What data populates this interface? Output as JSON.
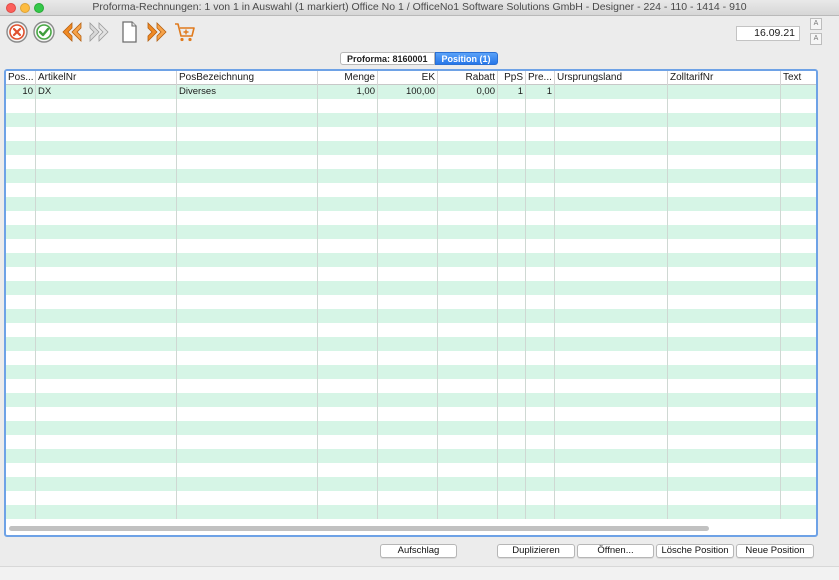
{
  "window": {
    "title": "Proforma-Rechnungen: 1 von 1 in Auswahl  (1 markiert) Office No 1 /  OfficeNo1 Software Solutions GmbH - Designer - 224 - 110 - 1414 - 910"
  },
  "toolbar": {
    "buttons": [
      "cancel-icon",
      "confirm-icon",
      "previous-icon",
      "next-icon",
      "new-document-icon",
      "fast-forward-icon",
      "cart-add-icon"
    ],
    "date": "16.09.21",
    "font_increase": "A",
    "font_decrease": "A"
  },
  "tabs": [
    {
      "label": "Proforma: 8160001",
      "active": false
    },
    {
      "label": "Position (1)",
      "active": true
    }
  ],
  "table": {
    "columns": [
      "Pos...",
      "ArtikelNr",
      "PosBezeichnung",
      "Menge",
      "EK",
      "Rabatt",
      "PpS",
      "Pre...",
      "Ursprungsland",
      "ZolltarifNr",
      "Text"
    ],
    "rows": [
      [
        "10",
        "DX",
        "Diverses",
        "1,00",
        "100,00",
        "0,00",
        "1",
        "1",
        "",
        "",
        ""
      ]
    ]
  },
  "buttons": {
    "aufschlag": "Aufschlag",
    "duplizieren": "Duplizieren",
    "oeffnen": "Öffnen...",
    "loesche_position": "Lösche Position",
    "neue_position": "Neue Position"
  },
  "colors": {
    "row_stripe": "#d6f5e6",
    "accent_blue": "#2777e9",
    "toolbar_orange": "#f08a24"
  }
}
